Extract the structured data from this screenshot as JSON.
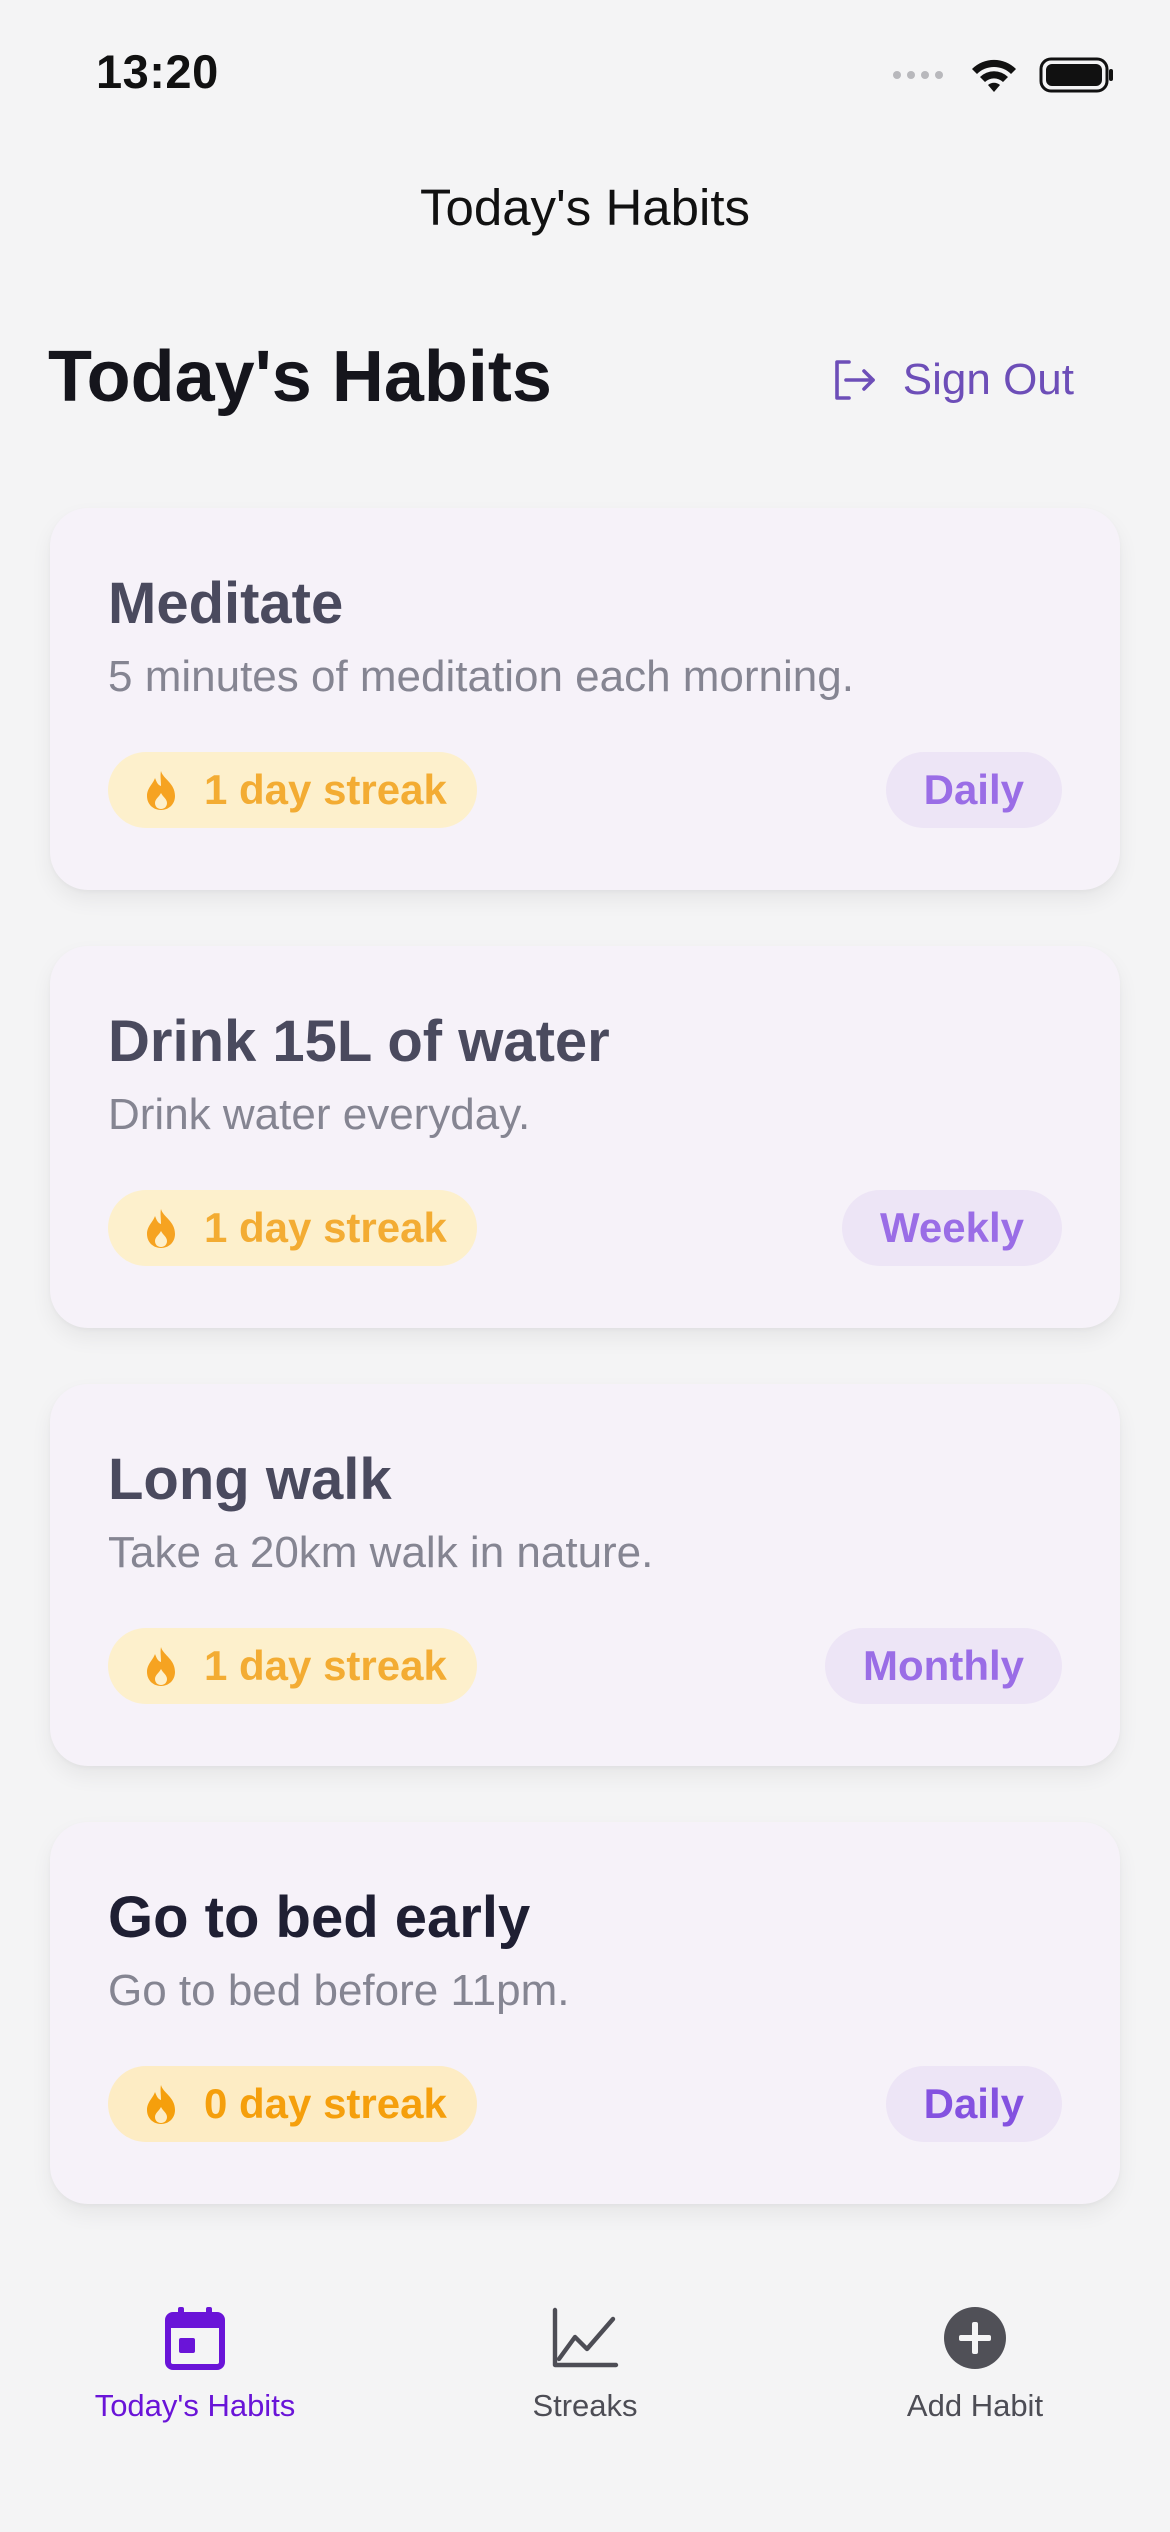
{
  "status_bar": {
    "time": "13:20"
  },
  "nav": {
    "title": "Today's Habits"
  },
  "header": {
    "title": "Today's Habits",
    "sign_out_label": "Sign Out"
  },
  "habits": [
    {
      "title": "Meditate",
      "description": "5 minutes of meditation each morning.",
      "streak": "1 day streak",
      "frequency": "Daily"
    },
    {
      "title": "Drink 15L of water",
      "description": "Drink water everyday.",
      "streak": "1 day streak",
      "frequency": "Weekly"
    },
    {
      "title": "Long walk",
      "description": "Take a 20km walk in nature.",
      "streak": "1 day streak",
      "frequency": "Monthly"
    },
    {
      "title": "Go to bed early",
      "description": "Go to bed before 11pm.",
      "streak": "0 day streak",
      "frequency": "Daily"
    }
  ],
  "tabs": [
    {
      "label": "Today's Habits",
      "icon": "calendar-icon",
      "active": true
    },
    {
      "label": "Streaks",
      "icon": "line-chart-icon",
      "active": false
    },
    {
      "label": "Add Habit",
      "icon": "plus-circle-icon",
      "active": false
    }
  ],
  "colors": {
    "accent": "#6a14d8",
    "streak": "#f3ac33",
    "frequency": "#9a6de6",
    "sign_out": "#6d4eb8"
  }
}
